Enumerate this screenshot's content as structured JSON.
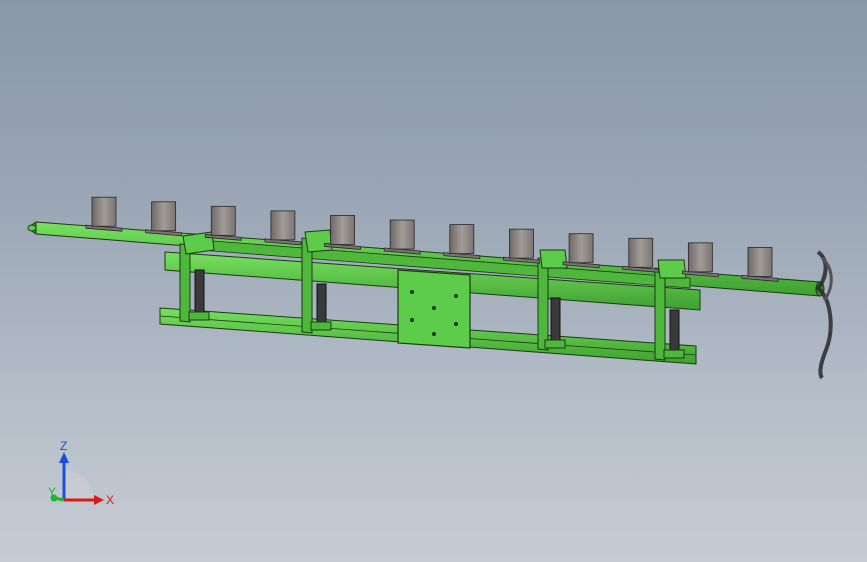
{
  "viewport": {
    "background_top": "#8a97a8",
    "background_bottom": "#c6ccd4",
    "model_color": "#5dcc4a",
    "model_edge_color": "#1a3a12",
    "block_color": "#8a8482",
    "cylinder_color": "#3a3a3a"
  },
  "model": {
    "name": "green-frame-assembly",
    "blocks_count": 12,
    "actuators_count": 4
  },
  "triad": {
    "z_label": "Z",
    "x_label": "X",
    "y_label": "Y",
    "z_color": "#1a4fd8",
    "x_color": "#d81a1a",
    "y_color": "#1ab82a"
  }
}
